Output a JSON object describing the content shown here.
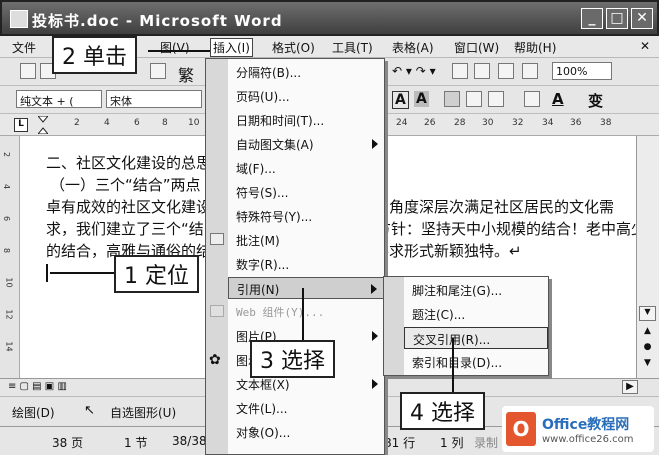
{
  "window": {
    "title": "投标书.doc - Microsoft Word",
    "minimize": "_",
    "maximize": "□",
    "close": "✕"
  },
  "menubar": {
    "items": [
      "文件",
      "2",
      "图(V)",
      "插入(I)",
      "格式(O)",
      "工具(T)",
      "表格(A)",
      "窗口(W)",
      "帮助(H)"
    ],
    "close_doc": "✕"
  },
  "toolbar": {
    "zoom": "100%",
    "style": "纯文本 + (",
    "font": "宋体",
    "glyph_A1": "A",
    "glyph_A2": "A",
    "glyph_A3": "A",
    "glyph_change": "变",
    "trad": "繁"
  },
  "ruler": {
    "numbers": [
      "2",
      "4",
      "6",
      "8",
      "10",
      "24",
      "26",
      "28",
      "30",
      "32",
      "34",
      "36",
      "38"
    ]
  },
  "vruler": {
    "numbers": [
      "2",
      "4",
      "6",
      "8",
      "10",
      "12",
      "14"
    ]
  },
  "document": {
    "lines": [
      "二、社区文化建设的总思",
      "（一）三个“结合”两点",
      "卓有成效的社区文化建设",
      "求，我们建立了三个“结",
      "的结合，高雅与通俗的结",
      "和了多角度深层次满足社区居民的文化需",
      "方针：坚持天中小规模的结合！老中高少",
      "要求形式新颖独特。↵"
    ]
  },
  "insert_menu": {
    "items": [
      {
        "label": "分隔符(B)...",
        "arrow": false
      },
      {
        "label": "页码(U)...",
        "arrow": false
      },
      {
        "label": "日期和时间(T)...",
        "arrow": false
      },
      {
        "label": "自动图文集(A)",
        "arrow": true
      },
      {
        "label": "域(F)...",
        "arrow": false
      },
      {
        "label": "符号(S)...",
        "arrow": false
      },
      {
        "label": "特殊符号(Y)...",
        "arrow": false
      },
      {
        "label": "批注(M)",
        "arrow": false
      },
      {
        "label": "数字(R)...",
        "arrow": false
      },
      {
        "label": "引用(N)",
        "arrow": true
      },
      {
        "label": "Web 组件(Y)...",
        "arrow": false
      },
      {
        "label": "图片(P)",
        "arrow": true
      },
      {
        "label": "图示(G)...",
        "arrow": false
      },
      {
        "label": "文本框(X)",
        "arrow": true
      },
      {
        "label": "文件(L)...",
        "arrow": false
      },
      {
        "label": "对象(O)...",
        "arrow": false
      }
    ]
  },
  "reference_menu": {
    "items": [
      "脚注和尾注(G)...",
      "题注(C)...",
      "交叉引用(R)...",
      "索引和目录(D)..."
    ]
  },
  "callouts": {
    "step1": "1 定位",
    "step2": "2 单击",
    "step3": "3 选择",
    "step4": "4 选择"
  },
  "drawbar": {
    "draw": "绘图(D)",
    "autoshape": "自选图形(U)"
  },
  "statusbar": {
    "page": "38 页",
    "section": "1 节",
    "pos": "38/38",
    "at": "81 行",
    "col": "1 列",
    "rec": "录制"
  },
  "logo": {
    "brand": "Office教程网",
    "url": "www.office26.com"
  }
}
